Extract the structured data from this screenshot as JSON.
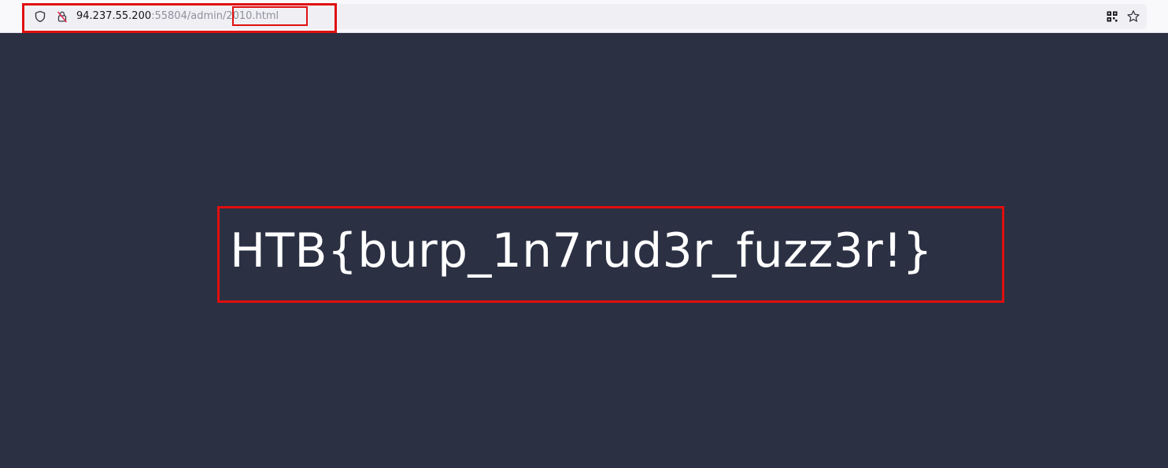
{
  "browser": {
    "url": {
      "host": "94.237.55.200",
      "rest_before_file": ":55804/admin/",
      "file": "2010.html"
    },
    "icons": {
      "tracking_protection": "shield-icon",
      "connection": "insecure-lock-icon",
      "extensions": "qr-grid-icon",
      "bookmark": "star-icon"
    }
  },
  "page": {
    "flag_text": "HTB{burp_1n7rud3r_fuzz3r!}",
    "background_color": "#2b3043",
    "text_color": "#ffffff"
  },
  "annotations": {
    "highlight_color": "#e00f0f"
  }
}
